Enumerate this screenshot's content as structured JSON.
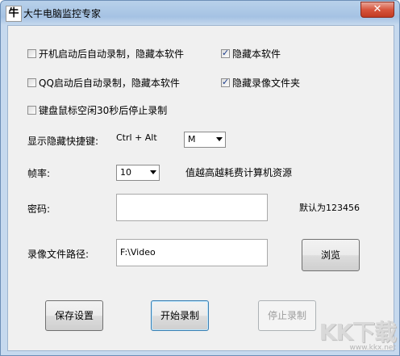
{
  "window": {
    "icon_char": "牛",
    "title": "大牛电脑监控专家",
    "close_symbol": "✕"
  },
  "options": {
    "autostart_record_hide": "开机启动后自动录制，隐藏本软件",
    "hide_software": "隐藏本软件",
    "qq_record_hide": "QQ启动后自动录制，隐藏本软件",
    "hide_record_folder": "隐藏录像文件夹",
    "idle_stop": "键盘鼠标空闲30秒后停止录制"
  },
  "checked": {
    "autostart_record_hide": false,
    "hide_software": true,
    "qq_record_hide": false,
    "hide_record_folder": true,
    "idle_stop": false
  },
  "hotkey": {
    "label": "显示隐藏快捷键:",
    "modifiers": "Ctrl + Alt",
    "key": "M"
  },
  "framerate": {
    "label": "帧率:",
    "value": "10",
    "hint": "值越高越耗费计算机资源"
  },
  "password": {
    "label": "密码:",
    "value": "",
    "default_hint": "默认为123456"
  },
  "path": {
    "label": "录像文件路径:",
    "value": "F:\\Video",
    "browse": "浏览"
  },
  "buttons": {
    "save": "保存设置",
    "start": "开始录制",
    "stop": "停止录制"
  },
  "watermark": {
    "logo": "KK下载",
    "url": "www.kkx.net"
  }
}
